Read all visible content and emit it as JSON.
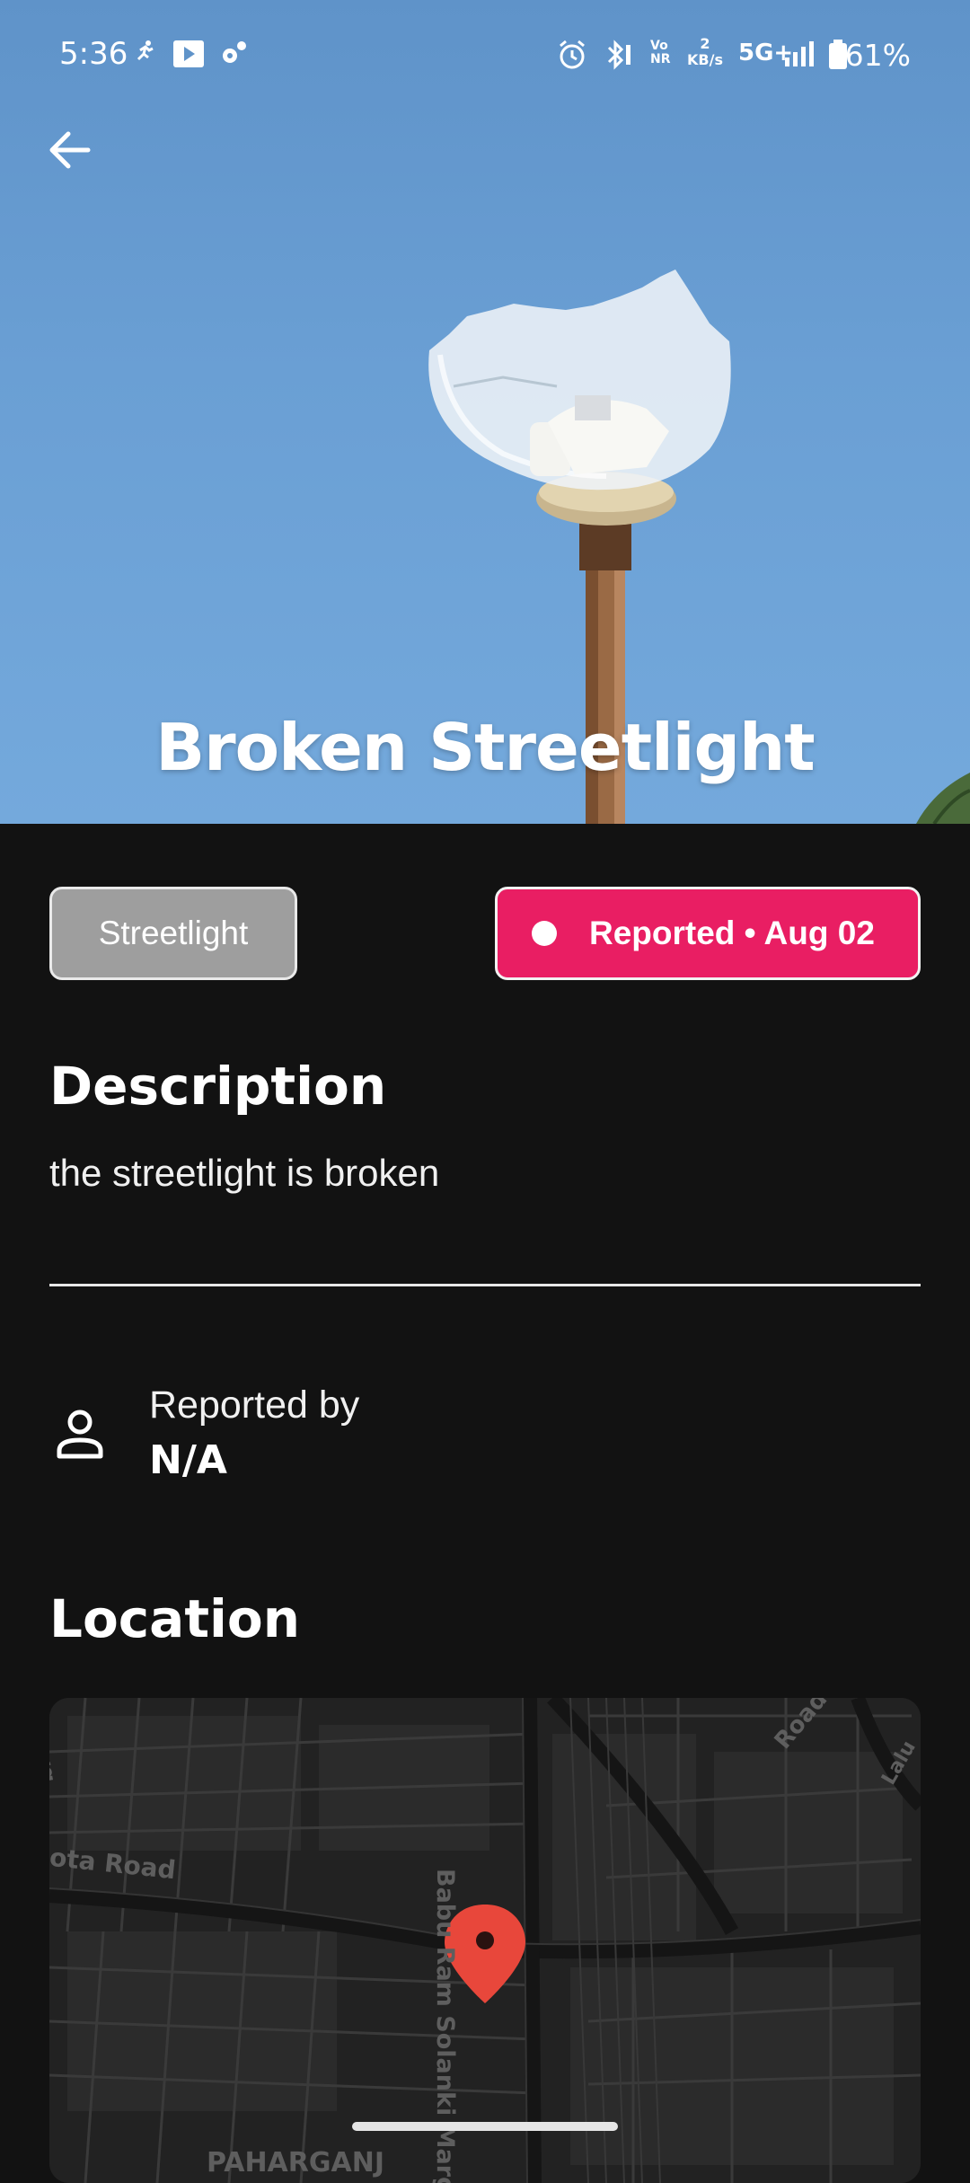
{
  "status_bar": {
    "time": "5:36",
    "vonr": "Vo\nNR",
    "net_speed": "2\nKB/s",
    "network": "5G+",
    "battery": "61%"
  },
  "hero": {
    "title": "Broken Streetlight"
  },
  "issue": {
    "category": "Streetlight",
    "status_text": "Reported • Aug 02",
    "status_color": "#e91e63"
  },
  "description": {
    "heading": "Description",
    "text": "the streetlight is broken"
  },
  "reporter": {
    "label": "Reported by",
    "value": "N/A"
  },
  "location": {
    "heading": "Location",
    "map_labels": {
      "road_left": "ota Road",
      "road_vertical": "Babu Ram Solanki Marg",
      "area": "PAHARGANJ",
      "road_top_left": "Marg",
      "road_top_right": "Road",
      "road_right": "Lalu"
    },
    "pin_color": "#e8473b"
  }
}
